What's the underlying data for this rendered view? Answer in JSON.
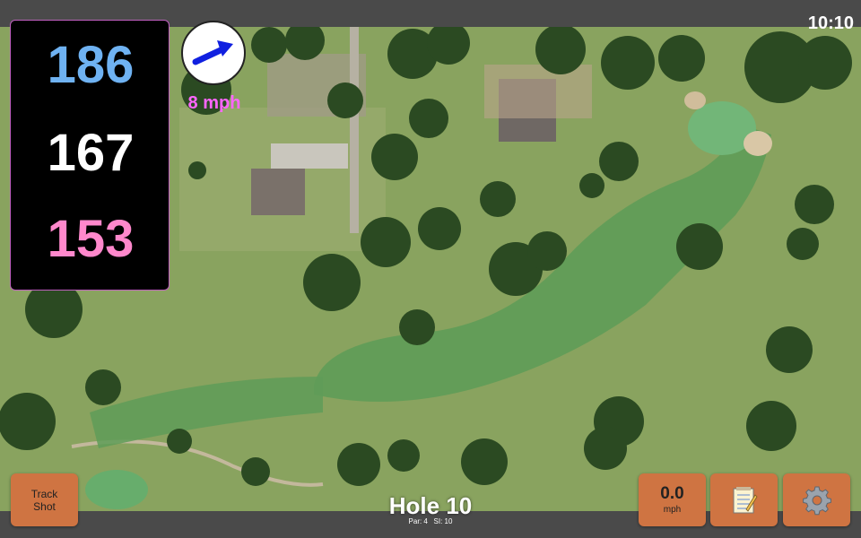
{
  "status": {
    "time": "10:10"
  },
  "yardages": {
    "back": "186",
    "center": "167",
    "front": "153",
    "colors": {
      "back": "#6fb2f2",
      "center": "#ffffff",
      "front": "#ff88cc"
    }
  },
  "wind": {
    "speed": "8 mph",
    "arrow_icon": "wind-direction-arrow-icon",
    "color": "#ff66ff"
  },
  "buttons": {
    "track_shot": {
      "line1": "Track",
      "line2": "Shot"
    },
    "speed": {
      "value": "0.0",
      "unit": "mph"
    },
    "notes": {
      "icon": "notepad-icon"
    },
    "settings": {
      "icon": "gear-icon"
    }
  },
  "hole": {
    "title": "Hole 10",
    "par": "Par: 4",
    "si": "SI: 10"
  },
  "theme": {
    "button_color": "#cf7442",
    "bar_color": "#4a4a4a",
    "fairway": "#5f9c58",
    "rough": "#88a35e"
  }
}
